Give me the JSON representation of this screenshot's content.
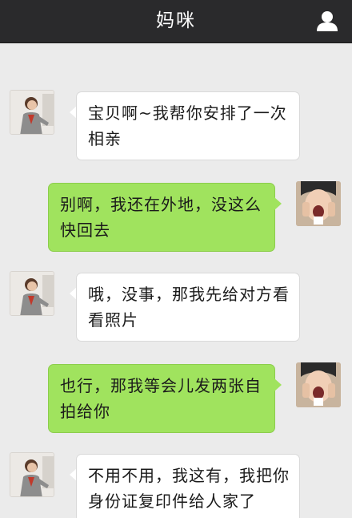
{
  "header": {
    "title": "妈咪",
    "profile_icon": "person-icon"
  },
  "messages": [
    {
      "sender": "mom",
      "text": "宝贝啊~我帮你安排了一次相亲"
    },
    {
      "sender": "me",
      "text": "别啊，我还在外地，没这么快回去"
    },
    {
      "sender": "mom",
      "text": "哦，没事，那我先给对方看看照片"
    },
    {
      "sender": "me",
      "text": "也行，那我等会儿发两张自拍给你"
    },
    {
      "sender": "mom",
      "text": "不用不用，我这有，我把你身份证复印件给人家了"
    }
  ],
  "colors": {
    "titlebar": "#2a2a2c",
    "background": "#ebebeb",
    "sent_bubble": "#a0e35e",
    "received_bubble": "#ffffff"
  }
}
